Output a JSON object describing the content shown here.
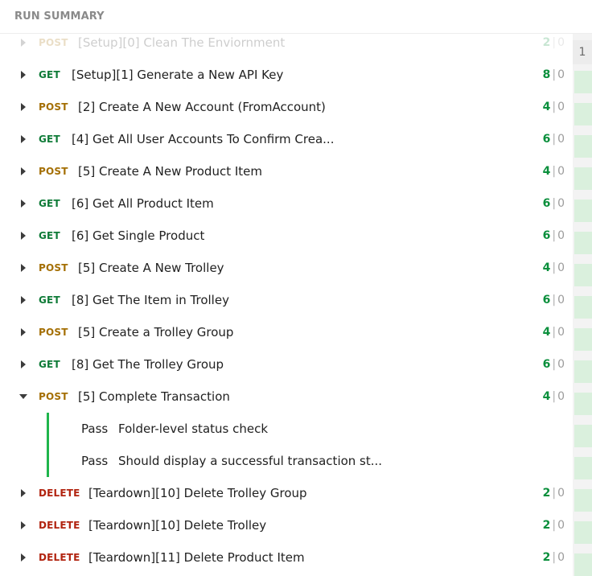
{
  "header": {
    "title": "RUN SUMMARY"
  },
  "iteration": {
    "number": "1"
  },
  "requests": [
    {
      "method": "POST",
      "name": "[Setup][0] Clean The Enviornment",
      "pass": "2",
      "fail": "0",
      "expanded": false
    },
    {
      "method": "GET",
      "name": "[Setup][1] Generate a New API Key",
      "pass": "8",
      "fail": "0",
      "expanded": false
    },
    {
      "method": "POST",
      "name": "[2] Create A New Account (FromAccount)",
      "pass": "4",
      "fail": "0",
      "expanded": false
    },
    {
      "method": "GET",
      "name": "[4] Get All User Accounts To Confirm Crea...",
      "pass": "6",
      "fail": "0",
      "expanded": false
    },
    {
      "method": "POST",
      "name": "[5] Create A New Product Item",
      "pass": "4",
      "fail": "0",
      "expanded": false
    },
    {
      "method": "GET",
      "name": "[6] Get All Product Item",
      "pass": "6",
      "fail": "0",
      "expanded": false
    },
    {
      "method": "GET",
      "name": "[6] Get Single Product",
      "pass": "6",
      "fail": "0",
      "expanded": false
    },
    {
      "method": "POST",
      "name": "[5] Create A New Trolley",
      "pass": "4",
      "fail": "0",
      "expanded": false
    },
    {
      "method": "GET",
      "name": "[8] Get The Item in Trolley",
      "pass": "6",
      "fail": "0",
      "expanded": false
    },
    {
      "method": "POST",
      "name": "[5] Create a Trolley Group",
      "pass": "4",
      "fail": "0",
      "expanded": false
    },
    {
      "method": "GET",
      "name": "[8] Get The Trolley Group",
      "pass": "6",
      "fail": "0",
      "expanded": false
    },
    {
      "method": "POST",
      "name": "[5] Complete Transaction",
      "pass": "4",
      "fail": "0",
      "expanded": true
    },
    {
      "method": "DELETE",
      "name": "[Teardown][10] Delete Trolley Group",
      "pass": "2",
      "fail": "0",
      "expanded": false
    },
    {
      "method": "DELETE",
      "name": "[Teardown][10] Delete Trolley",
      "pass": "2",
      "fail": "0",
      "expanded": false
    },
    {
      "method": "DELETE",
      "name": "[Teardown][11] Delete Product Item",
      "pass": "2",
      "fail": "0",
      "expanded": false
    }
  ],
  "tests": [
    {
      "status": "Pass",
      "name": "Folder-level status check"
    },
    {
      "status": "Pass",
      "name": "Should display a successful transaction st..."
    }
  ],
  "colors": {
    "get": "#0f7b38",
    "post": "#a46f04",
    "delete": "#b1230f",
    "pass": "#0a8f3c",
    "test_bar": "#1fb54c",
    "iteration_cell": "#daf0dd"
  }
}
